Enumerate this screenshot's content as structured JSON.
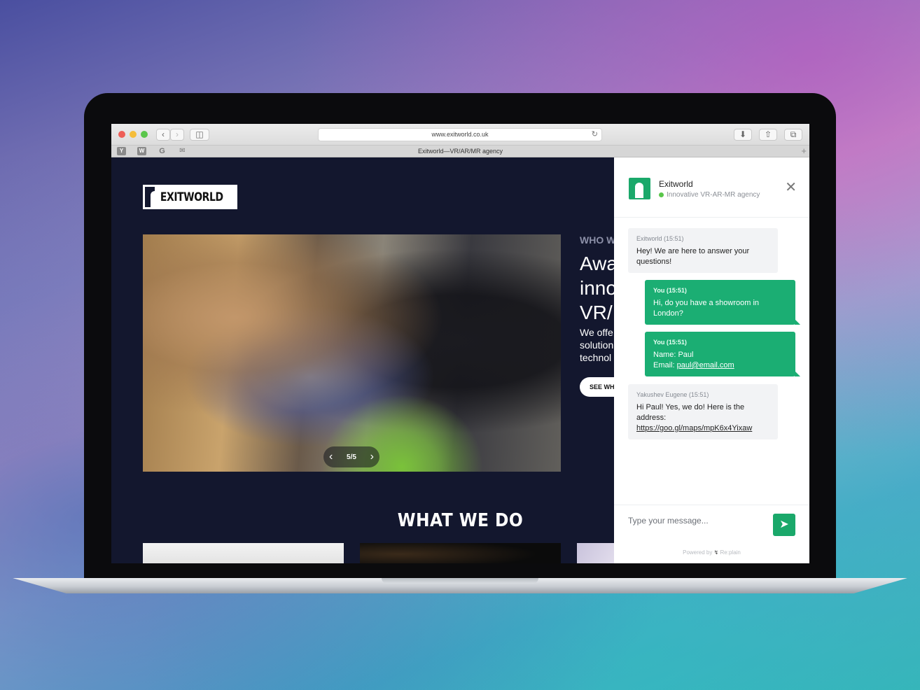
{
  "colors": {
    "accent": "#1aa86a",
    "page_bg": "#13172e",
    "chat_out": "#1bae73"
  },
  "browser": {
    "url": "www.exitworld.co.uk",
    "tab_title": "Exitworld—VR/AR/MR agency",
    "bookmark_icons": [
      "yahoo-icon",
      "wikipedia-icon",
      "google-icon",
      "mail-icon"
    ]
  },
  "page": {
    "logo_text": "EXITWORLD",
    "slider": {
      "counter": "5/5"
    },
    "who_label": "WHO W",
    "headline": [
      "Awa",
      "inno",
      "VR/"
    ],
    "subtext": [
      "We offe",
      "solution",
      "technol"
    ],
    "see_button": "SEE WH",
    "section_title": "WHAT WE DO"
  },
  "chat": {
    "name": "Exitworld",
    "status": "Innovative VR-AR-MR agency",
    "messages": [
      {
        "author": "Exitworld (15:51)",
        "text": "Hey! We are here to answer your questions!"
      },
      {
        "author": "You (15:51)",
        "text": "Hi, do you have a showroom in London?"
      },
      {
        "author": "You (15:51)",
        "line1": "Name: Paul",
        "email_label": "Email: ",
        "email": "paul@email.com"
      },
      {
        "author": "Yakushev Eugene (15:51)",
        "text": "Hi Paul! Yes, we do! Here is the address:",
        "link": "https://goo.gl/maps/mpK6x4Yixaw"
      }
    ],
    "input_placeholder": "Type your message...",
    "powered_by": "Powered by",
    "powered_brand": "Re:plain"
  }
}
